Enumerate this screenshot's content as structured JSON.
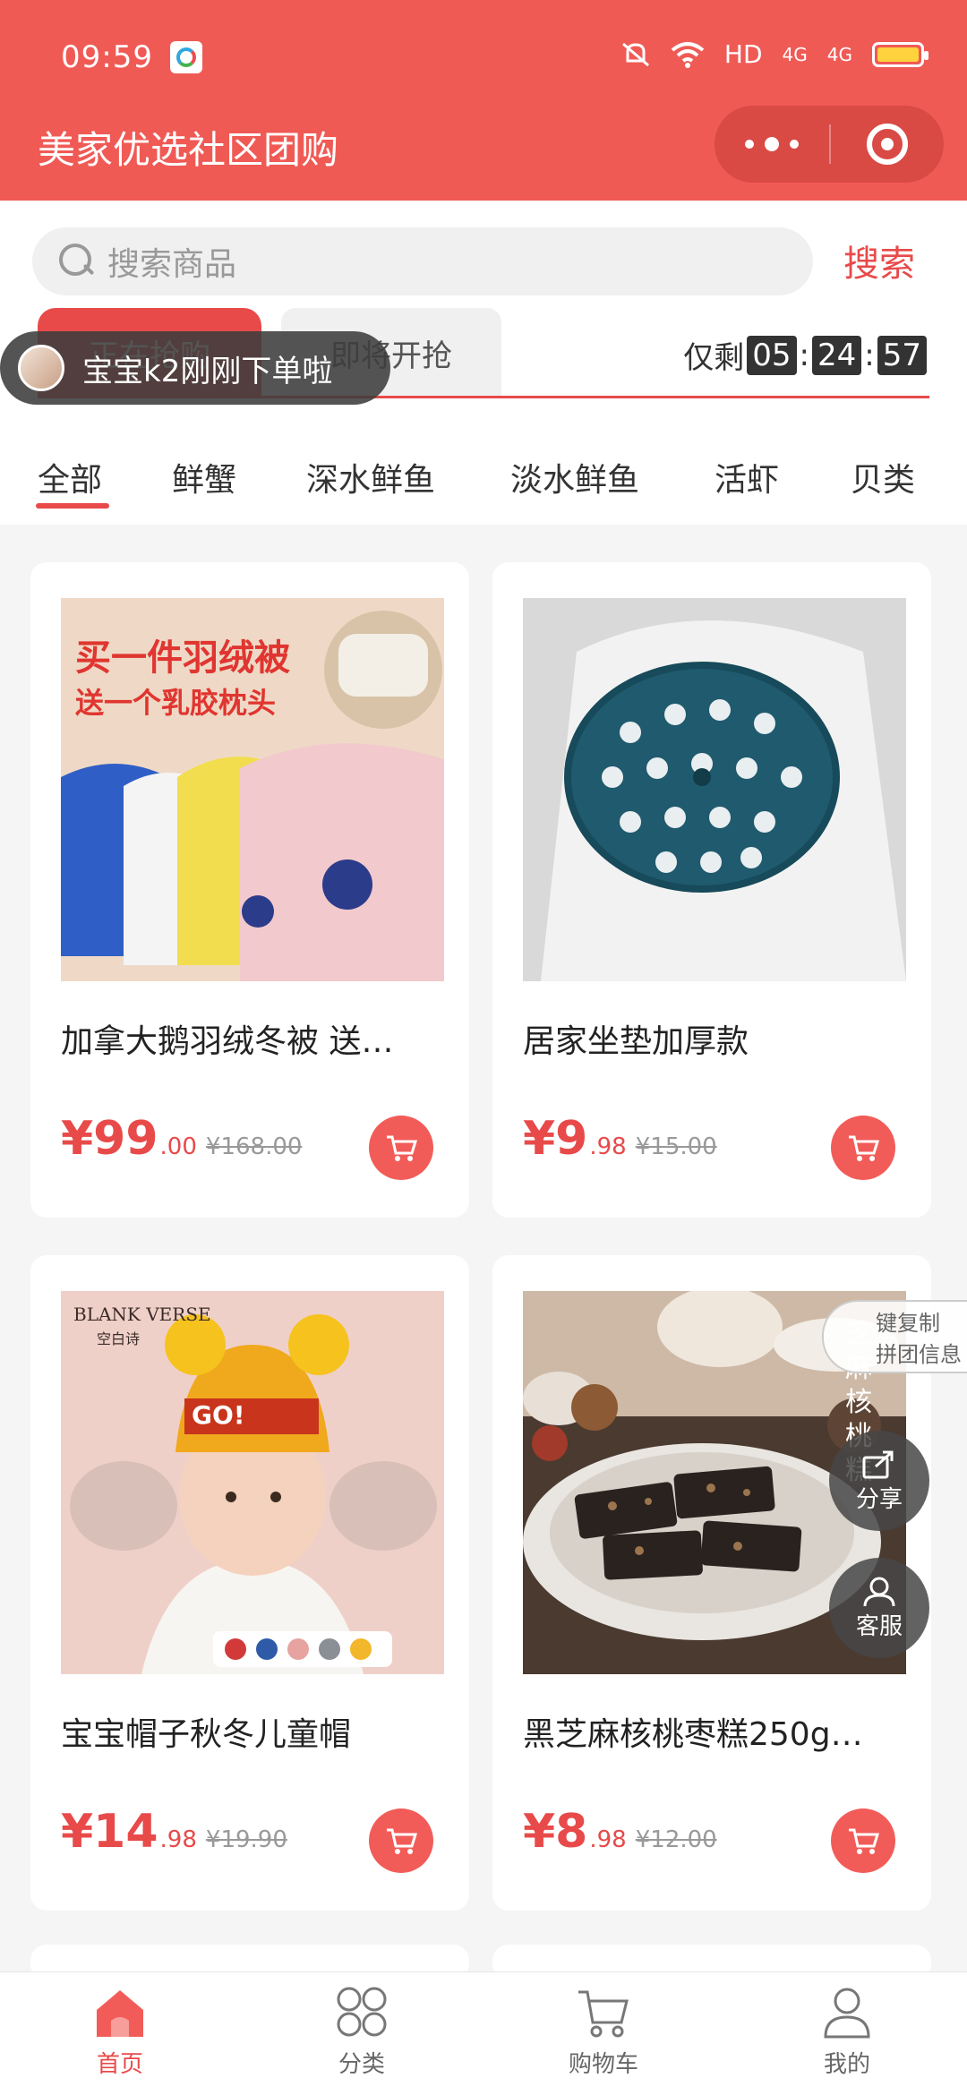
{
  "status_bar": {
    "time": "09:59",
    "network": "HD",
    "signal1": "4G",
    "signal2": "4G"
  },
  "header": {
    "title": "美家优选社区团购"
  },
  "search": {
    "placeholder": "搜索商品",
    "button": "搜索"
  },
  "tabs": {
    "active": "正在抢购",
    "next": "即将开抢"
  },
  "timer": {
    "label": "仅剩",
    "hours": "05",
    "minutes": "24",
    "seconds": "57"
  },
  "toast": {
    "text": "宝宝k2刚刚下单啦"
  },
  "categories": [
    "全部",
    "鲜蟹",
    "深水鲜鱼",
    "淡水鲜鱼",
    "活虾",
    "贝类"
  ],
  "products": [
    {
      "name": "加拿大鹅羽绒冬被 送…",
      "price_main": "¥99",
      "price_cents": ".00",
      "old_price": "¥168.00",
      "promo_line1": "买一件羽绒被",
      "promo_line2": "送一个乳胶枕头"
    },
    {
      "name": "居家坐垫加厚款",
      "price_main": "¥9",
      "price_cents": ".98",
      "old_price": "¥15.00"
    },
    {
      "name": "宝宝帽子秋冬儿童帽",
      "price_main": "¥14",
      "price_cents": ".98",
      "old_price": "¥19.90",
      "brand": "BLANK VERSE",
      "brand_cn": "空白诗",
      "hat_text": "GO!"
    },
    {
      "name": "黑芝麻核桃枣糕250g…",
      "price_main": "¥8",
      "price_cents": ".98",
      "old_price": "¥12.00",
      "package_text": "芝麻核桃糕"
    }
  ],
  "side": {
    "copy_line1": "键复制",
    "copy_line2": "拼团信息",
    "share": "分享",
    "service": "客服"
  },
  "bottom_nav": [
    {
      "label": "首页",
      "icon": "home-icon"
    },
    {
      "label": "分类",
      "icon": "category-icon"
    },
    {
      "label": "购物车",
      "icon": "cart-icon"
    },
    {
      "label": "我的",
      "icon": "user-icon"
    }
  ],
  "colors": {
    "brand": "#f05a55",
    "accent": "#e84a4a"
  }
}
